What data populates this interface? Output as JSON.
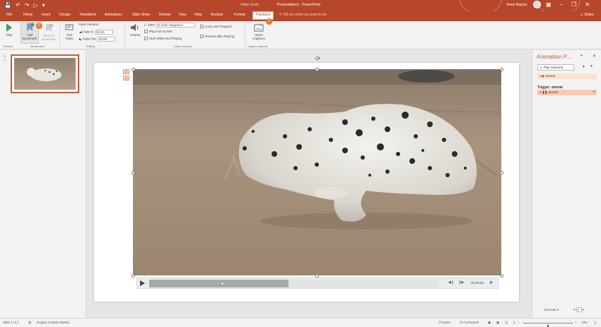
{
  "title_bar": {
    "qat_icons": [
      "save-icon",
      "undo-icon",
      "redo-icon",
      "start-from-beginning-icon",
      "customize-icon"
    ],
    "contextual_label": "Video Tools",
    "document_title": "Presentation1 - PowerPoint",
    "user_name": "Vivek Nayyar",
    "window_controls": [
      "ribbon-display-icon",
      "minimize-icon",
      "restore-icon",
      "close-icon"
    ]
  },
  "tabs": [
    "File",
    "Home",
    "Insert",
    "Design",
    "Transitions",
    "Animations",
    "Slide Show",
    "Review",
    "View",
    "Help",
    "Acrobat",
    "Format",
    "Playback"
  ],
  "active_tab": "Playback",
  "tell_me": "Tell me what you want to do",
  "share": "Share",
  "ribbon": {
    "play": "Play",
    "add_bookmark": [
      "Add",
      "Bookmark"
    ],
    "remove_bookmark": [
      "Remove",
      "Bookmark"
    ],
    "trim_video": [
      "Trim",
      "Video"
    ],
    "fade_duration": "Fade Duration",
    "fade_in_label": "Fade In:",
    "fade_in_value": "00.00",
    "fade_out_label": "Fade Out:",
    "fade_out_value": "00.00",
    "volume": "Volume",
    "start_label": "Start:",
    "start_value": "In Click Sequence",
    "play_full_screen": "Play Full Screen",
    "hide_while_not_playing": "Hide While Not Playing",
    "loop_until_stopped": "Loop until Stopped",
    "rewind_after_playing": "Rewind after Playing",
    "insert_captions": [
      "Insert",
      "Captions"
    ],
    "groups": [
      "Preview",
      "Bookmarks",
      "Editing",
      "Video Options",
      "Caption Options"
    ],
    "badge_1": "2",
    "badge_2": "1"
  },
  "slides": [
    {
      "number": "1",
      "star": "*"
    }
  ],
  "video": {
    "anim_tags": [
      "1",
      "▿"
    ],
    "timecode": "00:00.00",
    "progress": 0.48
  },
  "animation_pane": {
    "title": "Animation P...",
    "play_selected": "Play Selected",
    "items": [
      {
        "label": "1 ▶ animal"
      }
    ],
    "trigger_label": "Trigger: animal",
    "trigger_items": [
      {
        "label": "1 ❚❚ animal"
      }
    ],
    "seconds_label": "Seconds ▾",
    "zoom_value": "2"
  },
  "status": {
    "slide_info": "Slide 1 of 1",
    "language": "English (United States)",
    "notes": "Notes",
    "comments": "Comments",
    "zoom": "70%",
    "zoom_level": 0.7
  },
  "colors": {
    "accent": "#b7472a",
    "animation_highlight": "#f8c9b4",
    "badge": "#e8772e"
  }
}
